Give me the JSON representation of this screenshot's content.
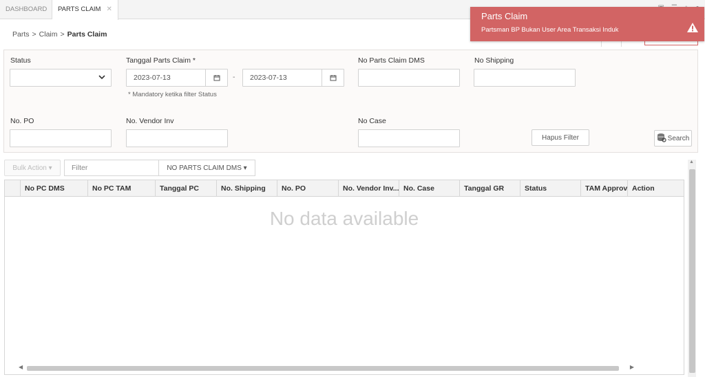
{
  "tabs": [
    {
      "label": "DASHBOARD"
    },
    {
      "label": "PARTS CLAIM",
      "close": "✕"
    }
  ],
  "breadcrumb": {
    "items": [
      "Parts",
      "Claim"
    ],
    "current": "Parts Claim",
    "separator": ">"
  },
  "filters": {
    "status_label": "Status",
    "tanggal_label": "Tanggal Parts Claim *",
    "date_from": "2023-07-13",
    "date_to": "2023-07-13",
    "date_separator": "-",
    "mandatory_note": "* Mandatory ketika filter Status",
    "no_pc_dms_label": "No Parts Claim DMS",
    "no_shipping_label": "No Shipping",
    "no_po_label": "No. PO",
    "no_vendor_inv_label": "No. Vendor Inv",
    "no_case_label": "No Case",
    "hapus_filter": "Hapus Filter",
    "search": "Search"
  },
  "toolbar": {
    "bulk_action": "Bulk Action ▾",
    "filter_placeholder": "Filter",
    "column_select": "NO PARTS CLAIM DMS ▾"
  },
  "grid": {
    "columns": [
      "No PC DMS",
      "No PC TAM",
      "Tanggal PC",
      "No. Shipping",
      "No. PO",
      "No. Vendor Inv....",
      "No. Case",
      "Tanggal GR",
      "Status",
      "TAM Approval",
      "Action"
    ],
    "empty_text": "No data available"
  },
  "toast": {
    "title": "Parts Claim",
    "message": "Partsman BP Bukan User Area Transaksi Induk"
  },
  "colors": {
    "toast_bg": "#d26464",
    "panel_bg": "#fcfaf9"
  }
}
